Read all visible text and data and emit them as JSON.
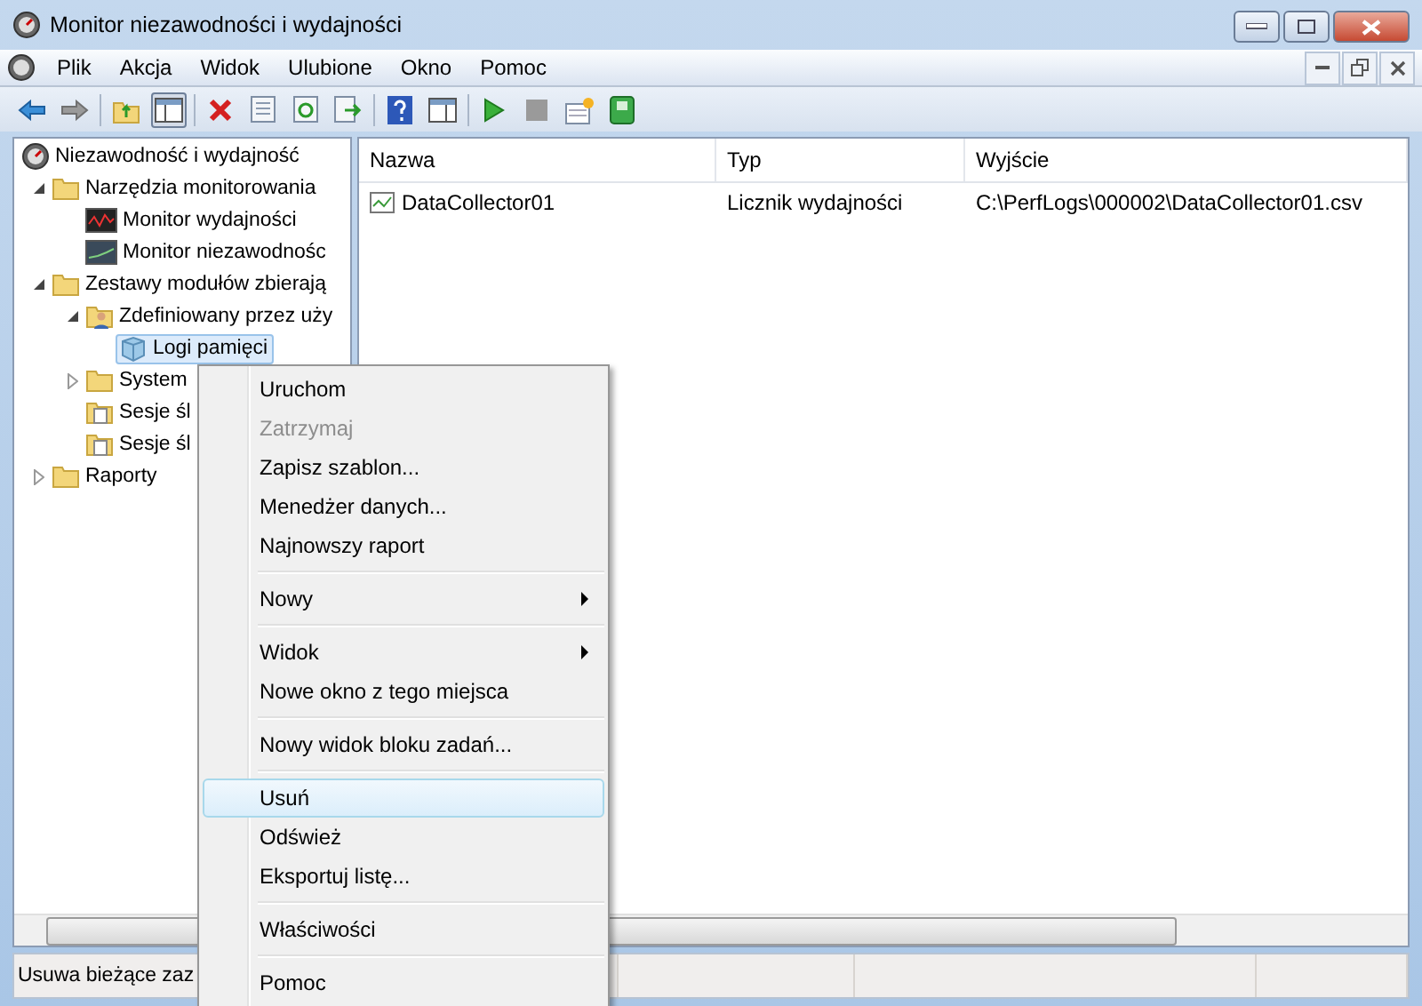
{
  "window": {
    "title": "Monitor niezawodności i wydajności"
  },
  "menu_bar": [
    "Plik",
    "Akcja",
    "Widok",
    "Ulubione",
    "Okno",
    "Pomoc"
  ],
  "tree": [
    {
      "label": "Niezawodność i wydajność",
      "kind": "gauge",
      "selected": false,
      "children": [
        {
          "label": "Narzędzia monitorowania",
          "kind": "folder",
          "expanded": true,
          "selected": false,
          "children": [
            {
              "label": "Monitor wydajności",
              "kind": "chart",
              "selected": false
            },
            {
              "label": "Monitor niezawodnośc",
              "kind": "graph",
              "selected": false
            }
          ]
        },
        {
          "label": "Zestawy modułów zbierają",
          "kind": "folder",
          "expanded": true,
          "selected": false,
          "children": [
            {
              "label": "Zdefiniowany przez uży",
              "kind": "userfolder",
              "expanded": true,
              "selected": false,
              "children": [
                {
                  "label": "Logi pamięci",
                  "kind": "cube",
                  "selected": true
                }
              ]
            },
            {
              "label": "System",
              "kind": "folder",
              "expanded": false,
              "selected": false
            },
            {
              "label": "Sesje śl",
              "kind": "doc",
              "selected": false
            },
            {
              "label": "Sesje śl",
              "kind": "doc",
              "selected": false
            }
          ]
        },
        {
          "label": "Raporty",
          "kind": "folder",
          "expanded": false,
          "selected": false
        }
      ]
    }
  ],
  "list": {
    "columns": [
      "Nazwa",
      "Typ",
      "Wyjście"
    ],
    "rows": [
      {
        "cells": [
          "DataCollector01",
          "Licznik wydajności",
          "C:\\PerfLogs\\000002\\DataCollector01.csv"
        ]
      }
    ]
  },
  "context_menu": [
    {
      "kind": "item",
      "label": "Uruchom",
      "disabled": false,
      "submenu": false,
      "selected": false
    },
    {
      "kind": "item",
      "label": "Zatrzymaj",
      "disabled": true,
      "submenu": false,
      "selected": false
    },
    {
      "kind": "item",
      "label": "Zapisz szablon...",
      "disabled": false,
      "submenu": false,
      "selected": false
    },
    {
      "kind": "item",
      "label": "Menedżer danych...",
      "disabled": false,
      "submenu": false,
      "selected": false
    },
    {
      "kind": "item",
      "label": "Najnowszy raport",
      "disabled": false,
      "submenu": false,
      "selected": false
    },
    {
      "kind": "separator"
    },
    {
      "kind": "item",
      "label": "Nowy",
      "disabled": false,
      "submenu": true,
      "selected": false
    },
    {
      "kind": "separator"
    },
    {
      "kind": "item",
      "label": "Widok",
      "disabled": false,
      "submenu": true,
      "selected": false
    },
    {
      "kind": "item",
      "label": "Nowe okno z tego miejsca",
      "disabled": false,
      "submenu": false,
      "selected": false
    },
    {
      "kind": "separator"
    },
    {
      "kind": "item",
      "label": "Nowy widok bloku zadań...",
      "disabled": false,
      "submenu": false,
      "selected": false
    },
    {
      "kind": "separator"
    },
    {
      "kind": "item",
      "label": "Usuń",
      "disabled": false,
      "submenu": false,
      "selected": true
    },
    {
      "kind": "item",
      "label": "Odśwież",
      "disabled": false,
      "submenu": false,
      "selected": false
    },
    {
      "kind": "item",
      "label": "Eksportuj listę...",
      "disabled": false,
      "submenu": false,
      "selected": false
    },
    {
      "kind": "separator"
    },
    {
      "kind": "item",
      "label": "Właściwości",
      "disabled": false,
      "submenu": false,
      "selected": false
    },
    {
      "kind": "separator"
    },
    {
      "kind": "item",
      "label": "Pomoc",
      "disabled": false,
      "submenu": false,
      "selected": false
    }
  ],
  "status_bar": {
    "text": "Usuwa bieżące zaz"
  }
}
